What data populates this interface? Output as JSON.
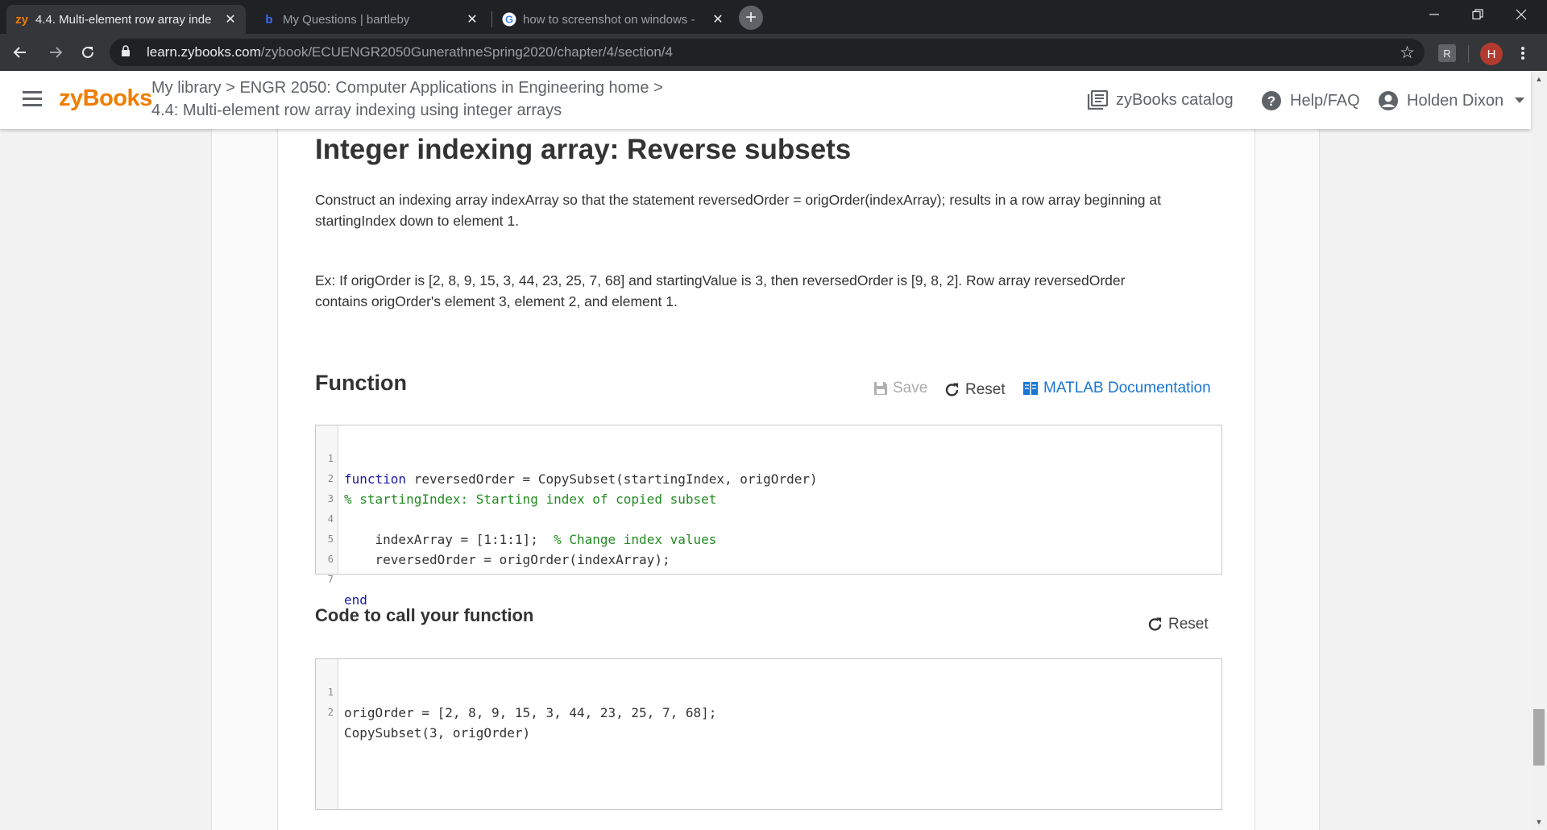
{
  "browser": {
    "tabs": [
      {
        "favicon": "zy",
        "title": "4.4. Multi-element row array inde",
        "active": true
      },
      {
        "favicon": "b",
        "title": "My Questions | bartleby",
        "active": false
      },
      {
        "favicon": "G",
        "title": "how to screenshot on windows -",
        "active": false
      }
    ],
    "new_tab": "+",
    "url_host": "learn.zybooks.com",
    "url_path": "/zybook/ECUENGR2050GunerathneSpring2020/chapter/4/section/4",
    "profile_initial": "H",
    "extension_label": "R"
  },
  "header": {
    "logo": "zyBooks",
    "breadcrumb_line1": "My library > ENGR 2050: Computer Applications in Engineering home >",
    "breadcrumb_line2": "4.4: Multi-element row array indexing using integer arrays",
    "catalog": "zyBooks catalog",
    "help": "Help/FAQ",
    "user": "Holden Dixon"
  },
  "content": {
    "title": "Integer indexing array: Reverse subsets",
    "para1": "Construct an indexing array indexArray so that the statement reversedOrder = origOrder(indexArray); results in a row array beginning at startingIndex down to element 1.",
    "para2": "Ex: If origOrder is [2, 8, 9, 15, 3, 44, 23, 25, 7, 68] and startingValue is 3, then reversedOrder is [9, 8, 2]. Row array reversedOrder contains origOrder's element 3, element 2, and element 1.",
    "function_heading": "Function",
    "save_label": "Save",
    "reset_label": "Reset",
    "matlab_doc_label": "MATLAB Documentation",
    "function_code": {
      "line_numbers": [
        "1",
        "2",
        "3",
        "4",
        "5",
        "6",
        "7"
      ],
      "l1_kw": "function",
      "l1_rest": " reversedOrder = CopySubset(startingIndex, origOrder)",
      "l2_comment": "% startingIndex: Starting index of copied subset",
      "l4_code": "    indexArray = [1:1:1];  ",
      "l4_comment": "% Change index values",
      "l5_code": "    reversedOrder = origOrder(indexArray);",
      "l7_kw": "end"
    },
    "call_heading": "Code to call your function",
    "call_reset_label": "Reset",
    "call_code": {
      "line_numbers": [
        "1",
        "2"
      ],
      "l1": "origOrder = [2, 8, 9, 15, 3, 44, 23, 25, 7, 68];",
      "l2": "CopySubset(3, origOrder)"
    }
  },
  "colors": {
    "brand": "#f07d00",
    "link": "#1976d2",
    "keyword": "#1a1aa6",
    "comment": "#228b22"
  }
}
